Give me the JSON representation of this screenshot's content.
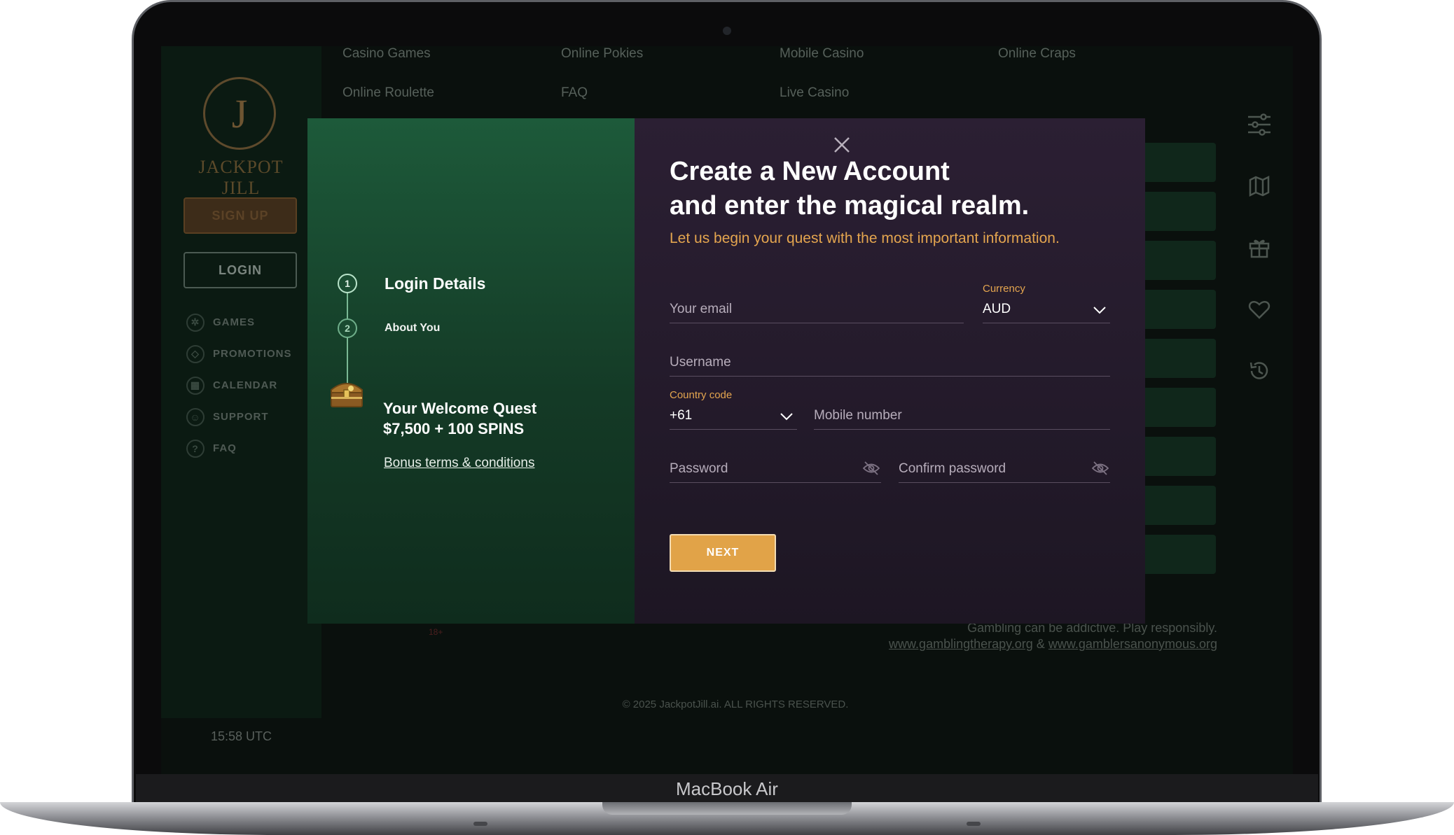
{
  "device": {
    "label": "MacBook Air"
  },
  "site": {
    "logo_text": "JACKPOT JILL",
    "logo_monogram": "J",
    "top_nav": [
      "Casino Games",
      "Online Pokies",
      "Mobile Casino",
      "Online Craps",
      "Online Roulette",
      "FAQ",
      "Live Casino"
    ],
    "sidebar": {
      "signup_label": "SIGN UP",
      "login_label": "LOGIN",
      "items": [
        {
          "label": "GAMES",
          "icon": "gear-icon"
        },
        {
          "label": "PROMOTIONS",
          "icon": "diamond-icon"
        },
        {
          "label": "CALENDAR",
          "icon": "calendar-icon"
        },
        {
          "label": "SUPPORT",
          "icon": "support-icon"
        },
        {
          "label": "FAQ",
          "icon": "faq-icon"
        }
      ],
      "clock": "15:58 UTC"
    },
    "right_rail_icons": [
      "filter-icon",
      "map-icon",
      "gift-icon",
      "heart-icon",
      "history-icon"
    ],
    "footer": {
      "responsible": "Gambling can be addictive. Play responsibly.",
      "link1": "www.gamblingtherapy.org",
      "amp": "&",
      "link2": "www.gamblersanonymous.org",
      "copyright": "© 2025 JackpotJill.ai. ALL RIGHTS RESERVED.",
      "badge": "18+"
    }
  },
  "modal": {
    "steps": [
      {
        "number": "1",
        "label": "Login Details"
      },
      {
        "number": "2",
        "label": "About You"
      }
    ],
    "quest_line1": "Your Welcome Quest",
    "quest_line2": "$7,500 + 100 SPINS",
    "bonus_link": "Bonus terms & conditions",
    "title_line1": "Create a New Account",
    "title_line2": "and enter the magical realm.",
    "subtitle": "Let us begin your quest with the most important information.",
    "email_placeholder": "Your email",
    "currency_label": "Currency",
    "currency_value": "AUD",
    "username_placeholder": "Username",
    "country_code_label": "Country code",
    "country_code_value": "+61",
    "mobile_placeholder": "Mobile number",
    "password_placeholder": "Password",
    "confirm_placeholder": "Confirm password",
    "next_label": "NEXT"
  },
  "colors": {
    "accent": "#e1a348",
    "modal_left": "#1d5a3a",
    "modal_right": "#2b1f33"
  }
}
